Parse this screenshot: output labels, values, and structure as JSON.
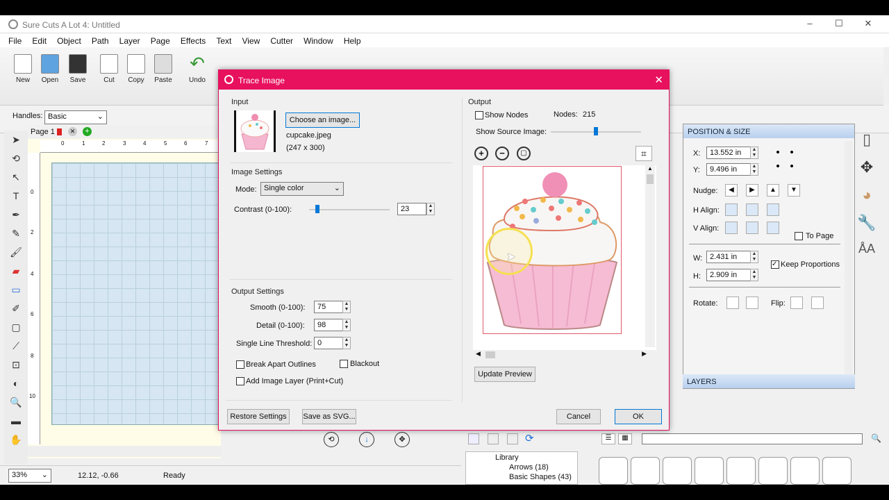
{
  "app": {
    "title": "Sure Cuts A Lot 4: Untitled",
    "menu": [
      "File",
      "Edit",
      "Object",
      "Path",
      "Layer",
      "Page",
      "Effects",
      "Text",
      "View",
      "Cutter",
      "Window",
      "Help"
    ],
    "toolbar": [
      "New",
      "Open",
      "Save",
      "Cut",
      "Copy",
      "Paste",
      "Undo"
    ],
    "handles_label": "Handles:",
    "handles_value": "Basic",
    "page_tab": "Page 1",
    "zoom": "33%",
    "coords": "12.12, -0.66",
    "status": "Ready",
    "ruler_ticks": [
      "0",
      "1",
      "2",
      "3",
      "4",
      "5",
      "6",
      "7"
    ],
    "vruler_ticks": [
      "0",
      "2",
      "4",
      "6",
      "8",
      "10"
    ]
  },
  "position_size": {
    "header": "POSITION & SIZE",
    "x_label": "X:",
    "x_value": "13.552 in",
    "y_label": "Y:",
    "y_value": "9.496 in",
    "nudge": "Nudge:",
    "h_align": "H Align:",
    "v_align": "V Align:",
    "to_page": "To Page",
    "w_label": "W:",
    "w_value": "2.431 in",
    "h_label": "H:",
    "h_value": "2.909 in",
    "keep_proportions": "Keep Proportions",
    "rotate": "Rotate:",
    "flip": "Flip:"
  },
  "layers_header": "LAYERS",
  "library": {
    "root": "Library",
    "items": [
      "Arrows (18)",
      "Basic Shapes (43)"
    ]
  },
  "dialog": {
    "title": "Trace Image",
    "input_label": "Input",
    "choose_button": "Choose an image...",
    "filename": "cupcake.jpeg",
    "dimensions": "(247 x 300)",
    "image_settings": "Image Settings",
    "mode_label": "Mode:",
    "mode_value": "Single color",
    "contrast_label": "Contrast (0-100):",
    "contrast_value": "23",
    "output_settings": "Output Settings",
    "smooth_label": "Smooth (0-100):",
    "smooth_value": "75",
    "detail_label": "Detail (0-100):",
    "detail_value": "98",
    "threshold_label": "Single Line Threshold:",
    "threshold_value": "0",
    "break_apart": "Break Apart Outlines",
    "blackout": "Blackout",
    "add_layer": "Add Image Layer (Print+Cut)",
    "restore_button": "Restore Settings",
    "save_svg_button": "Save as SVG...",
    "output_label": "Output",
    "show_nodes": "Show Nodes",
    "nodes_label": "Nodes:",
    "nodes_value": "215",
    "show_source": "Show Source Image:",
    "update_button": "Update Preview",
    "cancel_button": "Cancel",
    "ok_button": "OK"
  },
  "colors": {
    "accent": "#e8115d",
    "cupcake_pink": "#f5b6d0",
    "frosting": "#f8f8f8"
  }
}
